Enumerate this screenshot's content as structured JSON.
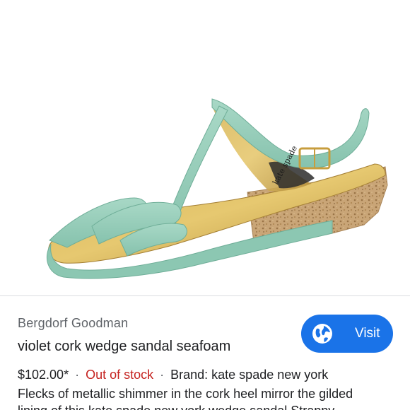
{
  "product": {
    "image_alt": "kate spade new york",
    "insole_brand_text": "kate spade"
  },
  "merchant": {
    "name": "Bergdorf Goodman"
  },
  "title": "violet cork wedge sandal seafoam",
  "visit_button": {
    "icon": "globe-icon",
    "label": "Visit",
    "color": "#1a73e8"
  },
  "details": {
    "price": "$102.00*",
    "separator": "·",
    "stock_status": "Out of stock",
    "stock_color": "#c5221f",
    "brand": "Brand: kate spade new york",
    "description_line1": "Flecks of metallic shimmer in the cork heel mirror the gilded",
    "description_line2": "lining of this kate spade new york wedge sandal Strappy"
  }
}
